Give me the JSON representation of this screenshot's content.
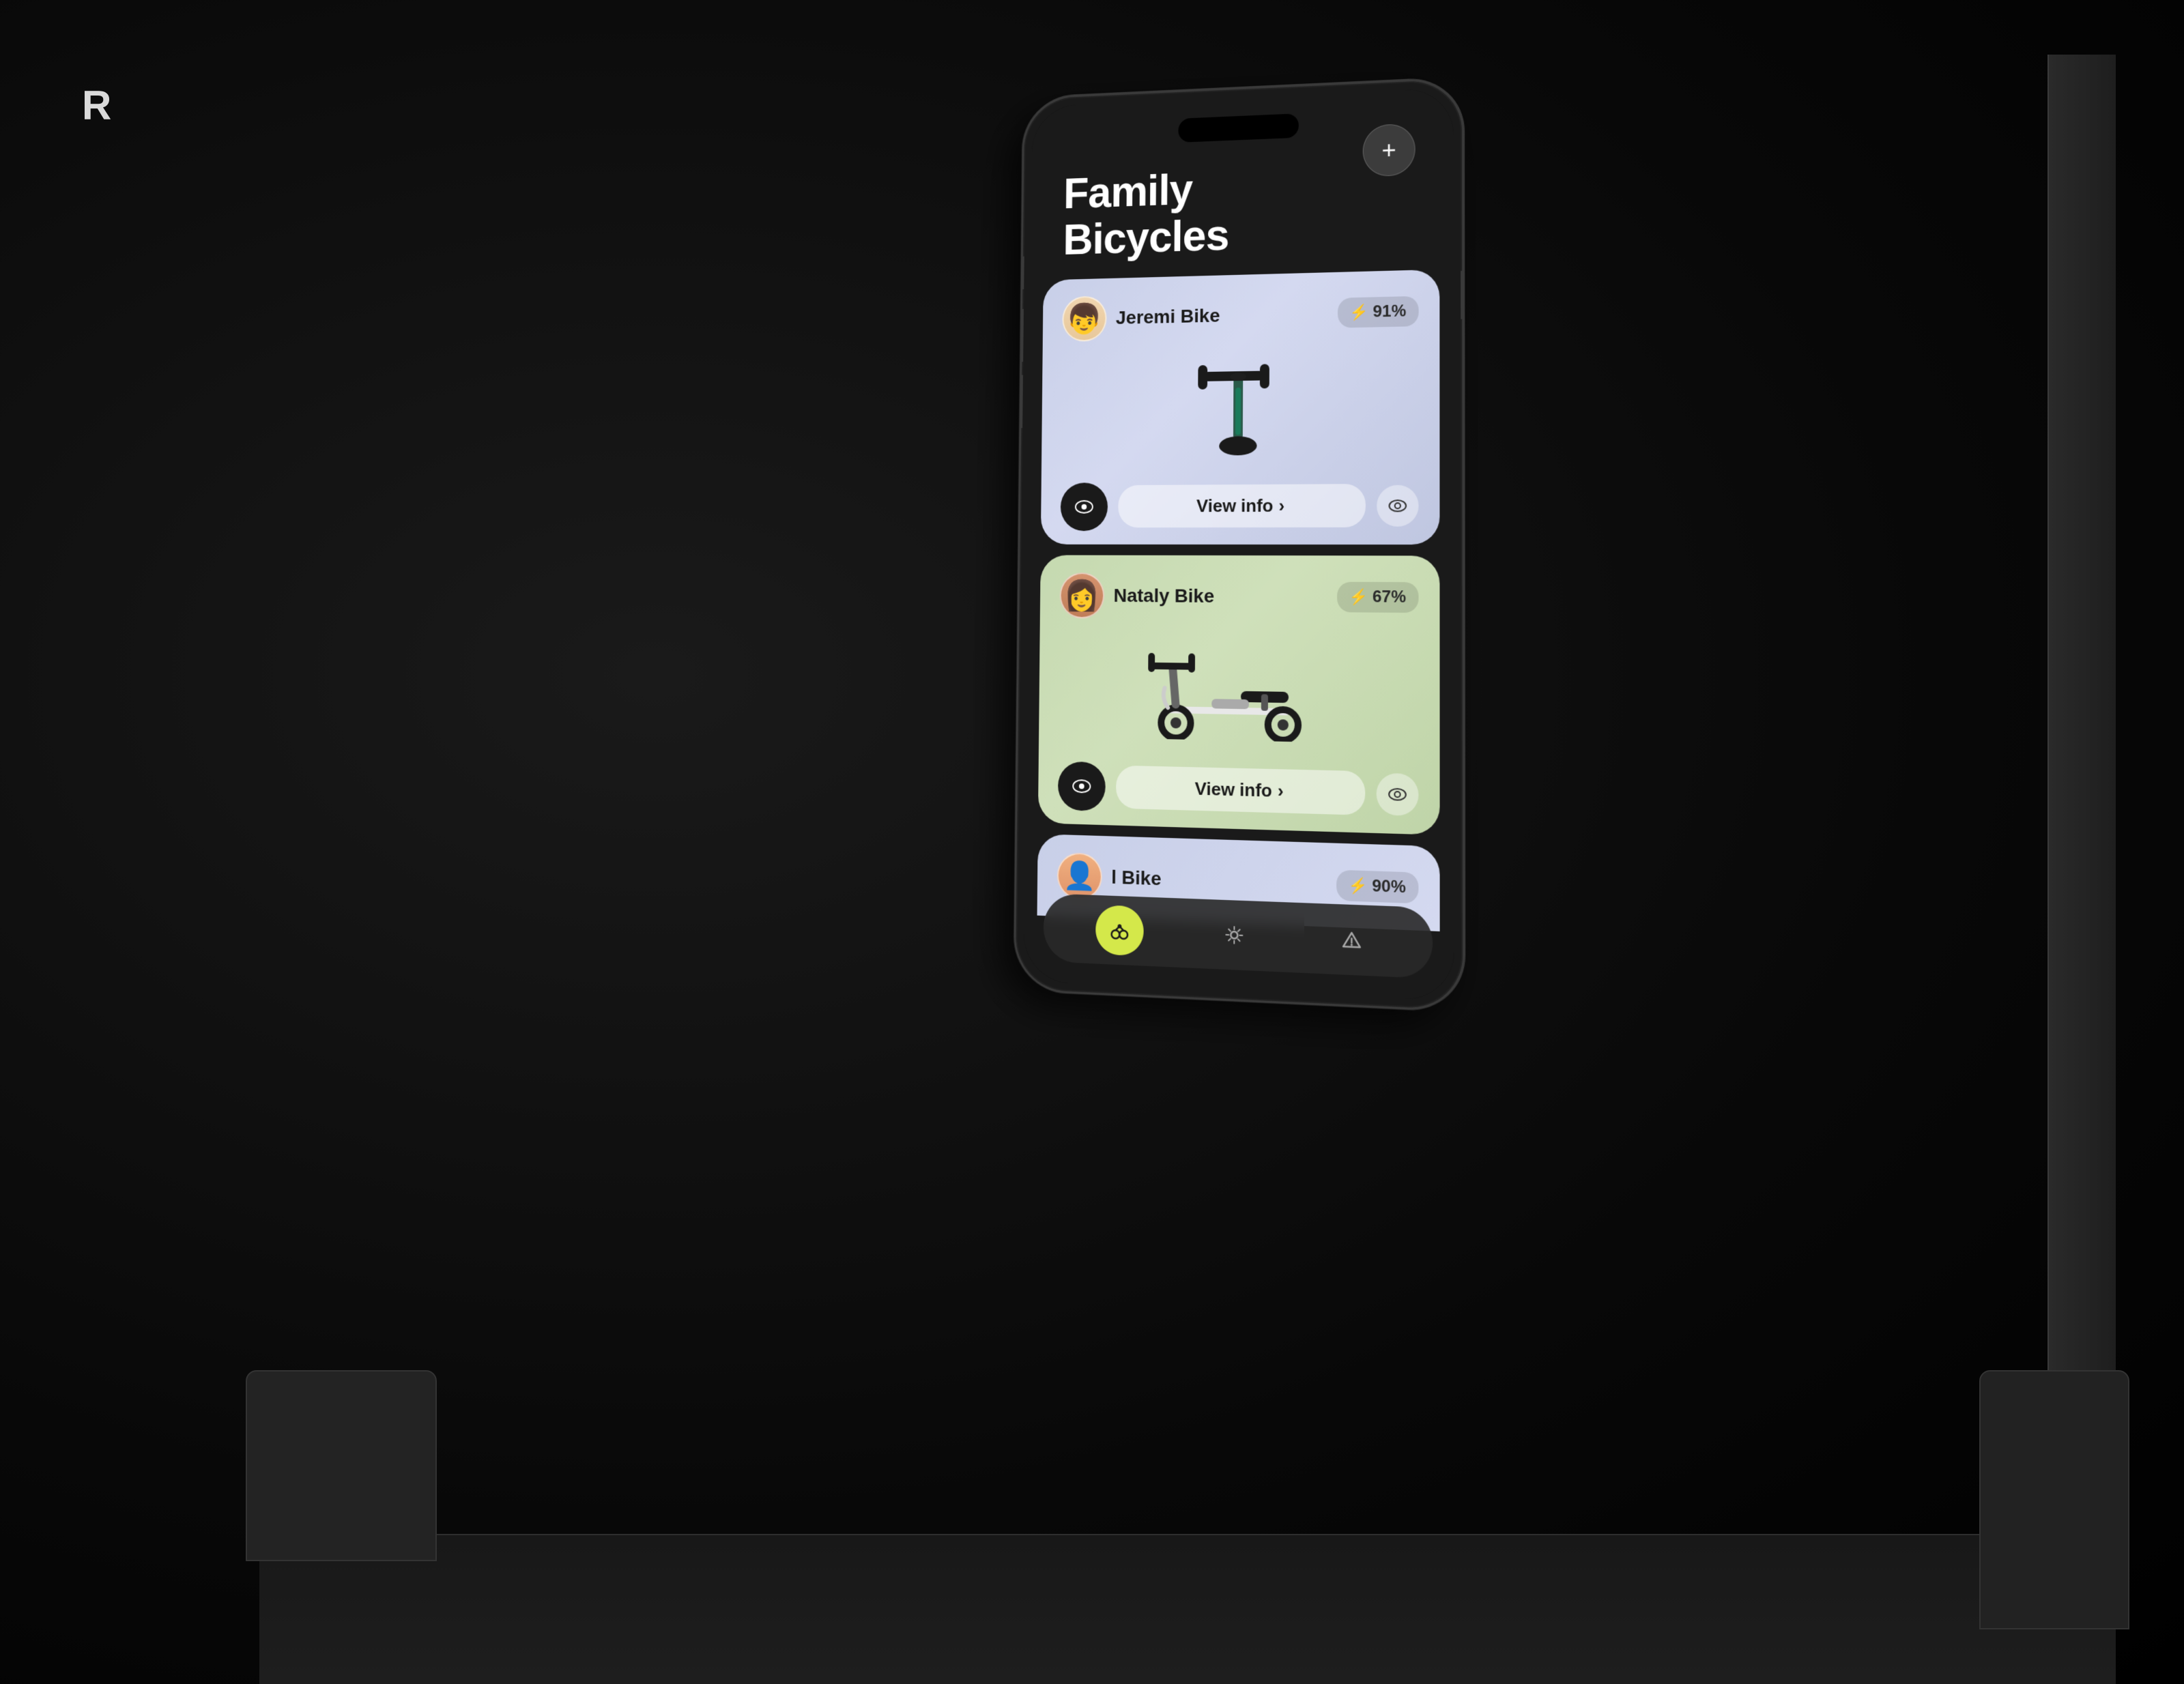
{
  "app": {
    "logo": "R",
    "background_color": "#0a0a0a"
  },
  "phone": {
    "plus_button_label": "+",
    "screen": {
      "title_line1": "Family",
      "title_line2": "Bicycles",
      "bikes": [
        {
          "id": "jeremi",
          "name": "Jeremi Bike",
          "battery": "91%",
          "battery_icon": "🔋",
          "card_color": "lavender",
          "view_info_label": "View info",
          "view_info_arrow": "›"
        },
        {
          "id": "nataly",
          "name": "Nataly Bike",
          "battery": "67%",
          "battery_icon": "🔋",
          "card_color": "green",
          "view_info_label": "View info",
          "view_info_arrow": "›"
        },
        {
          "id": "third",
          "name": "l Bike",
          "battery": "90%",
          "battery_icon": "🔋",
          "card_color": "lavender"
        }
      ]
    },
    "nav": {
      "items": [
        {
          "icon": "scissors",
          "label": "bike",
          "active": true
        },
        {
          "icon": "gear",
          "label": "settings",
          "active": false
        },
        {
          "icon": "alert",
          "label": "alerts",
          "active": false
        }
      ]
    }
  }
}
